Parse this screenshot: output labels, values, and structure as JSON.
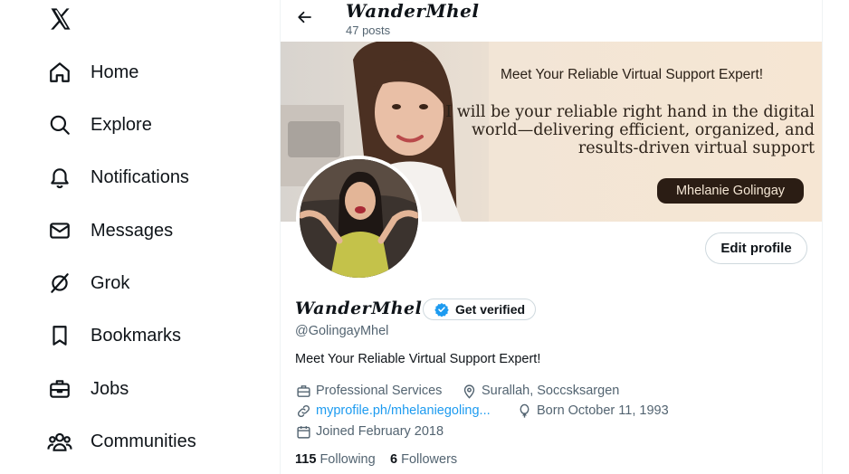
{
  "sidebar": {
    "items": [
      {
        "label": "Home",
        "icon": "home-icon"
      },
      {
        "label": "Explore",
        "icon": "search-icon"
      },
      {
        "label": "Notifications",
        "icon": "bell-icon"
      },
      {
        "label": "Messages",
        "icon": "envelope-icon"
      },
      {
        "label": "Grok",
        "icon": "grok-icon"
      },
      {
        "label": "Bookmarks",
        "icon": "bookmark-icon"
      },
      {
        "label": "Jobs",
        "icon": "briefcase-icon"
      },
      {
        "label": "Communities",
        "icon": "people-icon"
      }
    ]
  },
  "header": {
    "name": "WanderMhel",
    "posts": "47 posts"
  },
  "banner": {
    "title": "Meet Your Reliable Virtual Support Expert!",
    "quote": "I will be your reliable right hand in the digital world—delivering efficient, organized, and results-driven virtual support",
    "name_tag": "Mhelanie Golingay"
  },
  "profile": {
    "edit_label": "Edit profile",
    "name": "WanderMhel",
    "get_verified": "Get verified",
    "handle": "@GolingayMhel",
    "bio": "Meet Your Reliable Virtual Support Expert!",
    "category": "Professional Services",
    "location": "Surallah, Soccsksargen",
    "website": "myprofile.ph/mhelaniegoling...",
    "birthday": "Born October 11, 1993",
    "joined": "Joined February 2018",
    "following_count": "115",
    "following_label": "Following",
    "followers_count": "6",
    "followers_label": "Followers"
  },
  "colors": {
    "accent": "#1d9bf0",
    "text": "#0f1419",
    "muted": "#536471"
  }
}
